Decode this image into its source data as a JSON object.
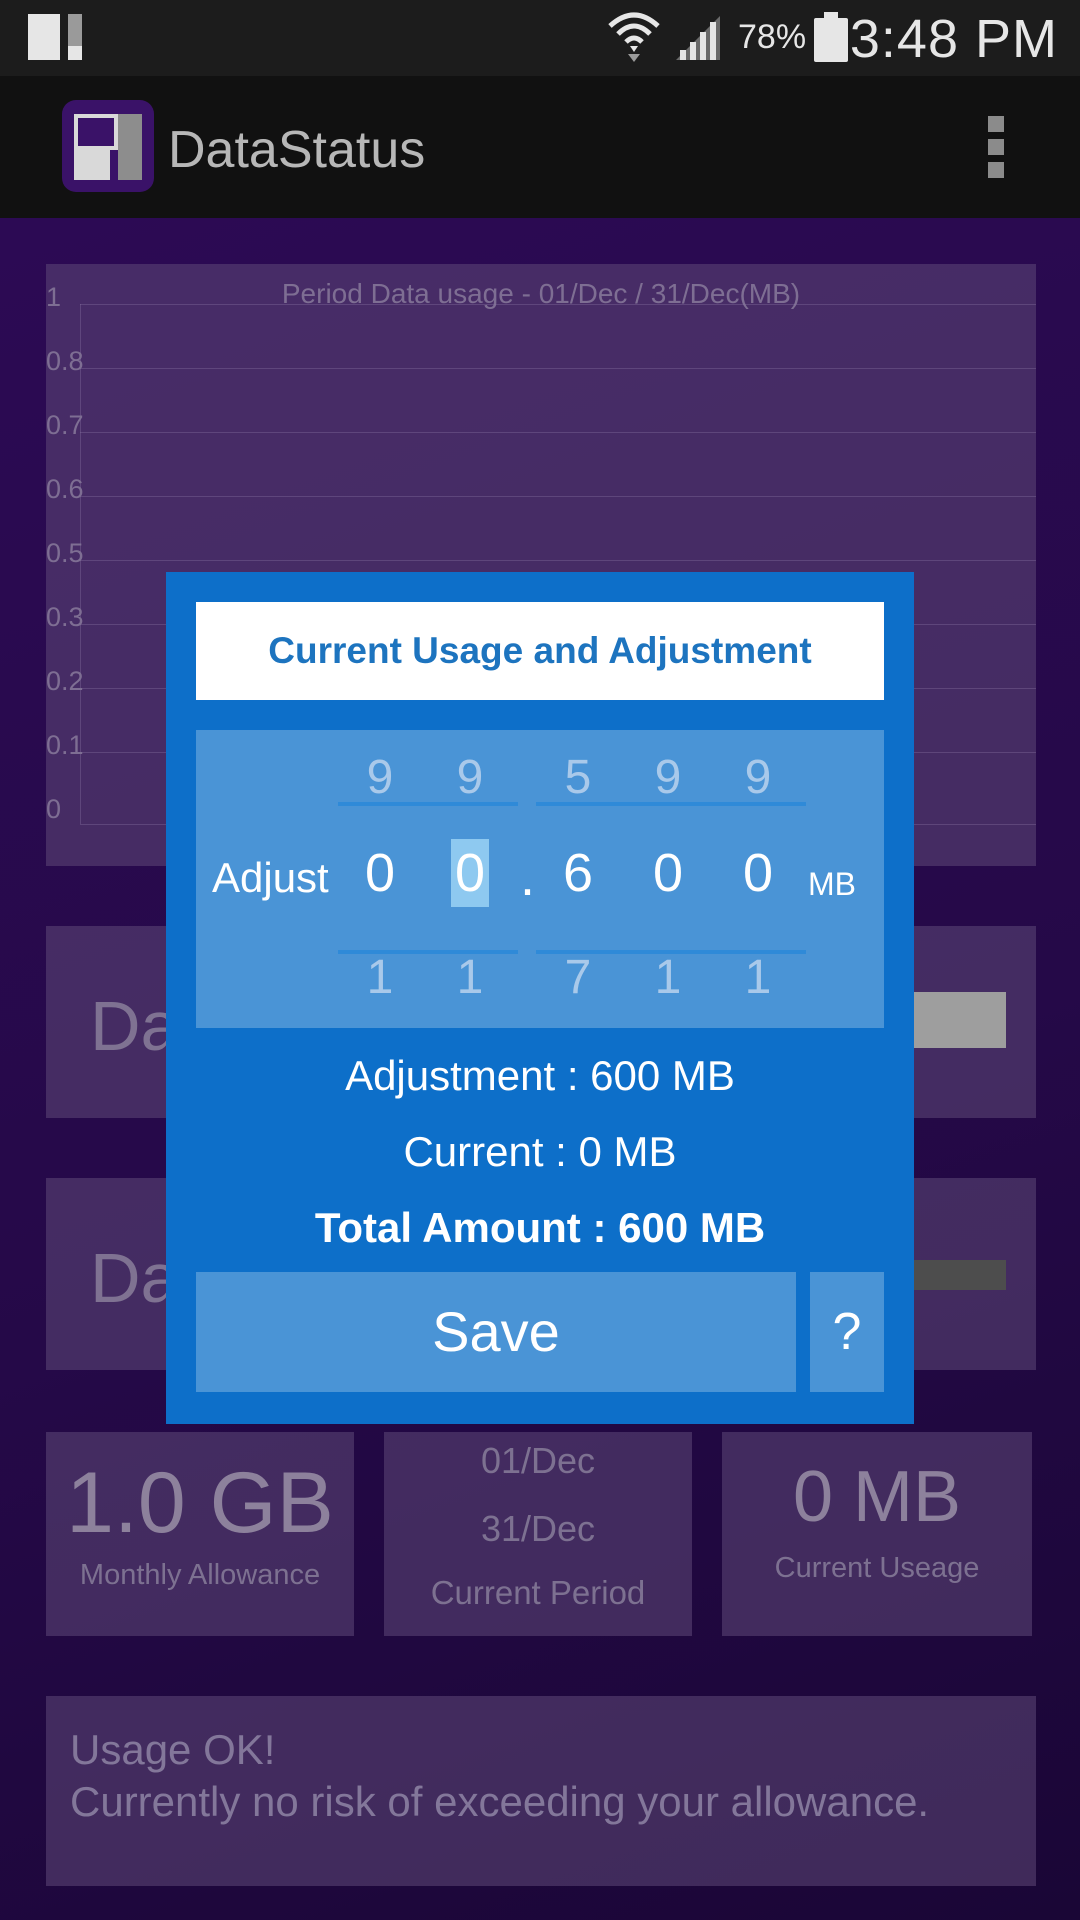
{
  "status_bar": {
    "battery_percent": "78%",
    "time": "3:48 PM",
    "icons": [
      "notification-icon",
      "wifi-icon",
      "signal-icon",
      "battery-icon"
    ]
  },
  "action_bar": {
    "app_title": "DataStatus",
    "menu_icon": "overflow-menu-icon"
  },
  "chart": {
    "title": "Period Data usage - 01/Dec / 31/Dec(MB)",
    "y_ticks": [
      "1",
      "0.8",
      "0.7",
      "0.6",
      "0.5",
      "0.3",
      "0.2",
      "0.1",
      "0"
    ]
  },
  "rows": {
    "row1_label": "Da",
    "row2_label": "Da"
  },
  "stats": {
    "allowance_value": "1.0 GB",
    "allowance_label": "Monthly Allowance",
    "period_start": "01/Dec",
    "period_end": "31/Dec",
    "period_label": "Current Period",
    "usage_value": "0 MB",
    "usage_label": "Current Useage"
  },
  "status_message": {
    "line1": "Usage OK!",
    "line2": "Currently no risk of exceeding your allowance."
  },
  "dialog": {
    "title": "Current Usage and Adjustment",
    "adjust_label": "Adjust",
    "unit": "MB",
    "decimal_point": ".",
    "digits": [
      {
        "prev": "9",
        "current": "0",
        "next": "1"
      },
      {
        "prev": "9",
        "current": "0",
        "next": "1"
      },
      {
        "prev": "5",
        "current": "6",
        "next": "7"
      },
      {
        "prev": "9",
        "current": "0",
        "next": "1"
      },
      {
        "prev": "9",
        "current": "0",
        "next": "1"
      }
    ],
    "selected_digit_index": 1,
    "adjustment_text": "Adjustment :  600 MB",
    "current_text": "Current : 0 MB",
    "total_text": "Total Amount :  600 MB",
    "save_label": "Save",
    "help_label": "?"
  },
  "colors": {
    "dialog_bg": "#0d6fc9",
    "dialog_panel": "#4a94d6",
    "title_text": "#1d74bf",
    "selected_digit": "#8ec9f0",
    "app_bg": "#2c0a54"
  }
}
